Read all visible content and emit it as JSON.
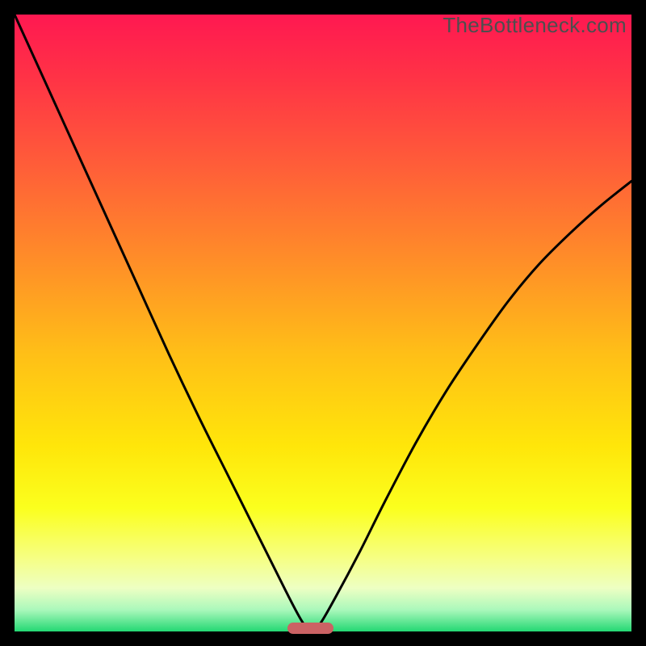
{
  "watermark": "TheBottleneck.com",
  "colors": {
    "black": "#000000",
    "curve": "#000000",
    "marker": "#cb6264",
    "gradient_stops": [
      {
        "pos": 0.0,
        "color": "#ff1851"
      },
      {
        "pos": 0.1,
        "color": "#ff3246"
      },
      {
        "pos": 0.25,
        "color": "#ff5f38"
      },
      {
        "pos": 0.4,
        "color": "#ff8e28"
      },
      {
        "pos": 0.55,
        "color": "#ffbf17"
      },
      {
        "pos": 0.7,
        "color": "#ffe60a"
      },
      {
        "pos": 0.8,
        "color": "#fbff1e"
      },
      {
        "pos": 0.88,
        "color": "#f6ff82"
      },
      {
        "pos": 0.93,
        "color": "#edffc3"
      },
      {
        "pos": 0.965,
        "color": "#aaf8bb"
      },
      {
        "pos": 1.0,
        "color": "#24d873"
      }
    ]
  },
  "chart_data": {
    "type": "line",
    "title": "",
    "xlabel": "",
    "ylabel": "",
    "xlim": [
      0,
      1
    ],
    "ylim": [
      0,
      1
    ],
    "optimum_x": 0.48,
    "series": [
      {
        "name": "bottleneck-curve",
        "x": [
          0.0,
          0.05,
          0.1,
          0.15,
          0.2,
          0.25,
          0.3,
          0.35,
          0.4,
          0.44,
          0.465,
          0.48,
          0.495,
          0.52,
          0.56,
          0.6,
          0.65,
          0.7,
          0.75,
          0.8,
          0.85,
          0.9,
          0.95,
          1.0
        ],
        "y": [
          1.0,
          0.89,
          0.78,
          0.67,
          0.56,
          0.45,
          0.345,
          0.245,
          0.145,
          0.065,
          0.018,
          0.0,
          0.012,
          0.055,
          0.13,
          0.21,
          0.305,
          0.39,
          0.465,
          0.535,
          0.595,
          0.645,
          0.69,
          0.73
        ]
      }
    ],
    "marker": {
      "x_center": 0.48,
      "width": 0.075,
      "y": 0.0
    }
  }
}
